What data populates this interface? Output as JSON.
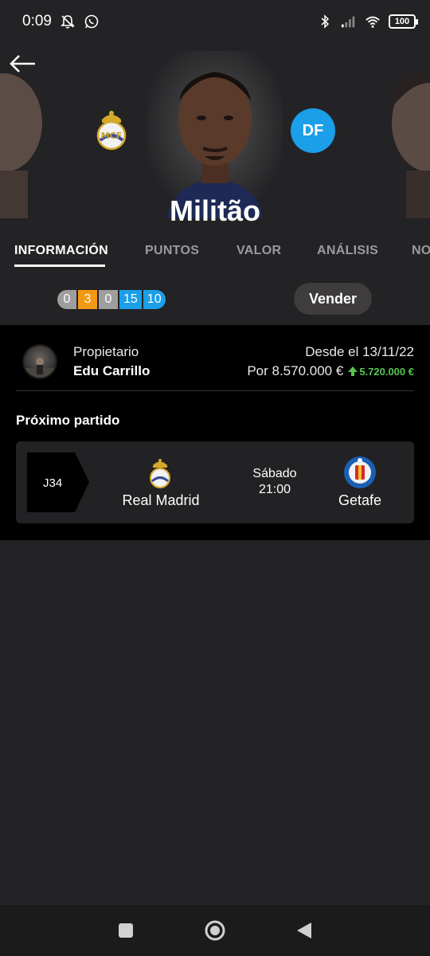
{
  "status_bar": {
    "time": "0:09",
    "battery": "100"
  },
  "player": {
    "name": "Militão",
    "position": "DF",
    "club_crest": "real-madrid-crest",
    "position_color": "#1a9fe8"
  },
  "tabs": [
    {
      "label": "INFORMACIÓN",
      "active": true
    },
    {
      "label": "PUNTOS",
      "active": false
    },
    {
      "label": "VALOR",
      "active": false
    },
    {
      "label": "ANÁLISIS",
      "active": false
    },
    {
      "label": "NO",
      "active": false
    }
  ],
  "stats": [
    {
      "value": "0",
      "color": "#9e9e9e"
    },
    {
      "value": "3",
      "color": "#f39814"
    },
    {
      "value": "0",
      "color": "#9e9e9e"
    },
    {
      "value": "15",
      "color": "#1a9fe8"
    },
    {
      "value": "10",
      "color": "#1a9fe8"
    }
  ],
  "sell_button": "Vender",
  "owner": {
    "label": "Propietario",
    "name": "Edu Carrillo",
    "since": "Desde el 13/11/22",
    "price": "Por 8.570.000 €",
    "gain": "5.720.000 €",
    "gain_color": "#56c451"
  },
  "next_match": {
    "title": "Próximo partido",
    "round": "J34",
    "home_team": "Real Madrid",
    "away_team": "Getafe",
    "day": "Sábado",
    "time": "21:00"
  },
  "nav": {
    "icons": [
      "recents-square-icon",
      "home-circle-icon",
      "back-triangle-icon"
    ]
  }
}
